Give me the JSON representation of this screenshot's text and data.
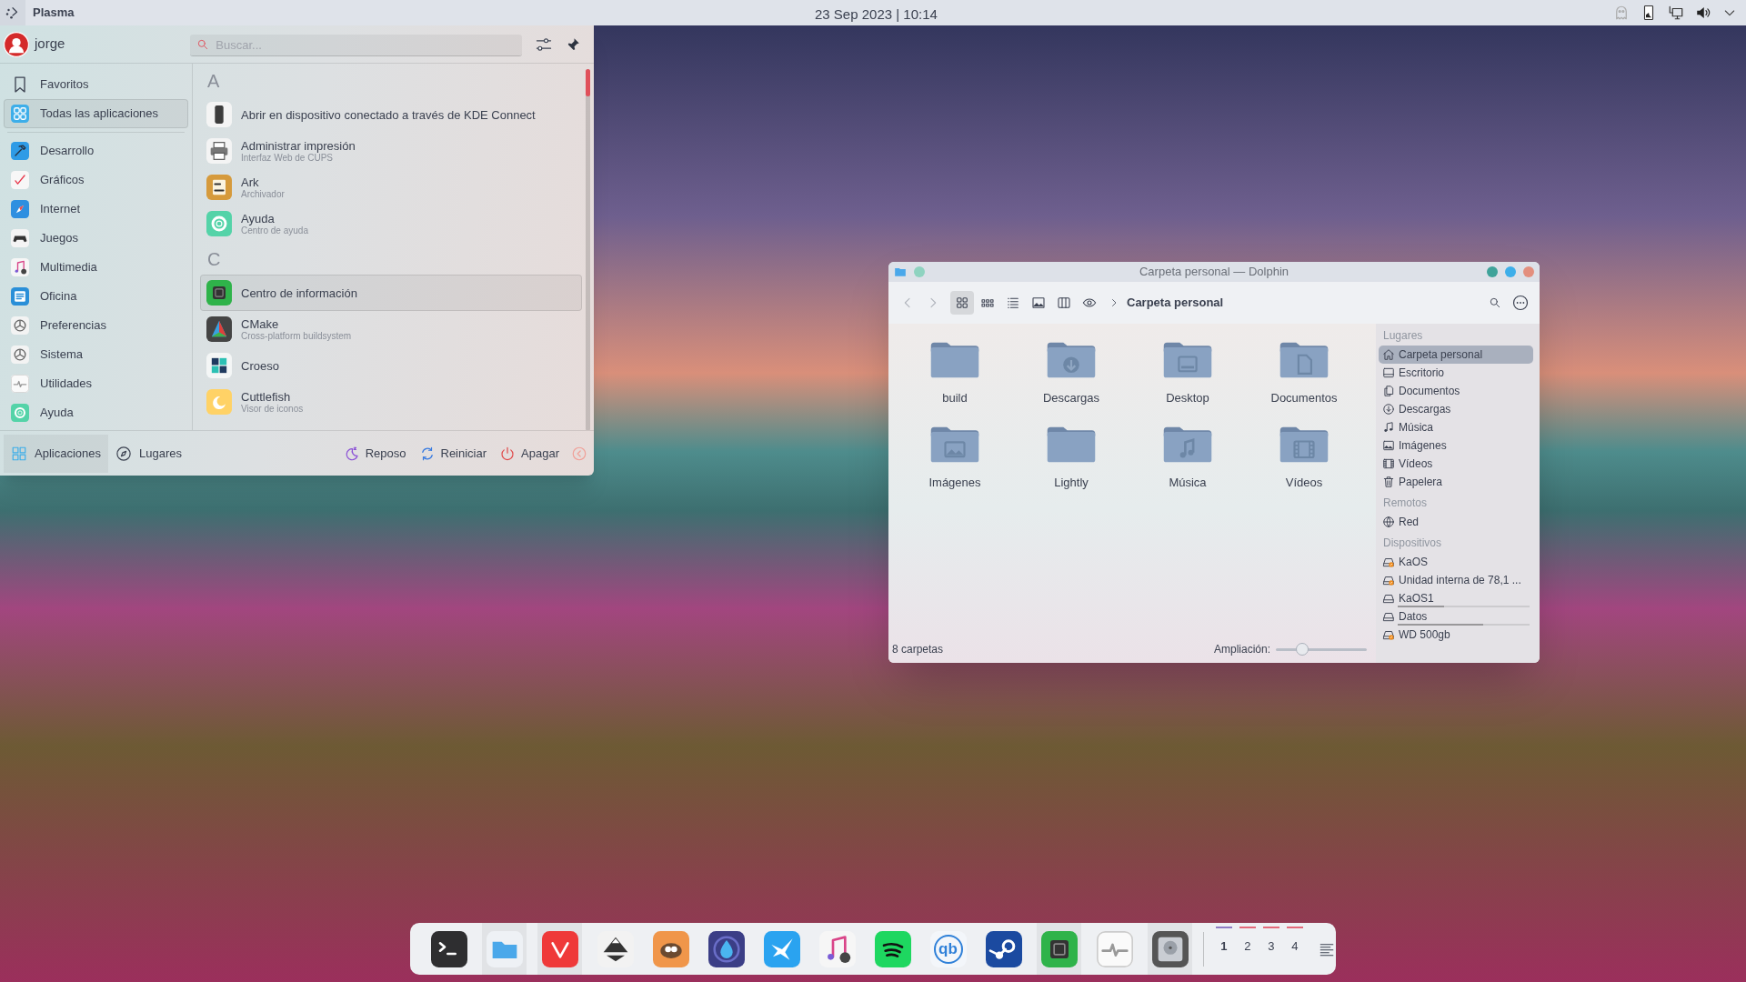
{
  "top_panel": {
    "app_title": "Plasma",
    "clock": "23 Sep 2023 | 10:14"
  },
  "launcher": {
    "user": "jorge",
    "search": {
      "placeholder": "Buscar..."
    },
    "pinned": [
      {
        "label": "Favoritos",
        "kind": "bookmark",
        "selected": false
      },
      {
        "label": "Todas las aplicaciones",
        "kind": "grid",
        "selected": true
      }
    ],
    "categories": [
      {
        "label": "Desarrollo",
        "kind": "hammer",
        "selected": false
      },
      {
        "label": "Gráficos",
        "kind": "brush",
        "selected": false
      },
      {
        "label": "Internet",
        "kind": "compass",
        "selected": false
      },
      {
        "label": "Juegos",
        "kind": "gamepad",
        "selected": false
      },
      {
        "label": "Multimedia",
        "kind": "note",
        "selected": false
      },
      {
        "label": "Oficina",
        "kind": "document",
        "selected": false
      },
      {
        "label": "Preferencias",
        "kind": "gear",
        "selected": false
      },
      {
        "label": "Sistema",
        "kind": "gear",
        "selected": false
      },
      {
        "label": "Utilidades",
        "kind": "pulse",
        "selected": false
      },
      {
        "label": "Ayuda",
        "kind": "lifebuoy",
        "selected": false
      }
    ],
    "sections": [
      {
        "letter": "A",
        "apps": [
          {
            "name": "Abrir en dispositivo conectado a través de KDE Connect",
            "kind": "phone",
            "selected": false
          },
          {
            "name": "Administrar impresión",
            "description": "Interfaz Web de CUPS",
            "kind": "printer",
            "selected": false
          },
          {
            "name": "Ark",
            "description": "Archivador",
            "kind": "package",
            "selected": false
          },
          {
            "name": "Ayuda",
            "description": "Centro de ayuda",
            "kind": "lifebuoy",
            "selected": false
          }
        ]
      },
      {
        "letter": "C",
        "apps": [
          {
            "name": "Centro de información",
            "kind": "chip",
            "selected": true
          },
          {
            "name": "CMake",
            "description": "Cross-platform buildsystem",
            "kind": "triangle",
            "selected": false
          },
          {
            "name": "Croeso",
            "kind": "squares",
            "selected": false
          },
          {
            "name": "Cuttlefish",
            "description": "Visor de iconos",
            "kind": "crescent",
            "selected": false
          }
        ]
      }
    ],
    "tabs": [
      {
        "label": "Aplicaciones",
        "kind": "grid-outline",
        "selected": true
      },
      {
        "label": "Lugares",
        "kind": "compass-outline",
        "selected": false
      }
    ],
    "power": [
      {
        "label": "Reposo",
        "kind": "moon"
      },
      {
        "label": "Reiniciar",
        "kind": "restart"
      },
      {
        "label": "Apagar",
        "kind": "power"
      }
    ]
  },
  "dolphin": {
    "title": "Carpeta personal — Dolphin",
    "breadcrumb": "Carpeta personal",
    "view_modes": [
      {
        "kind": "icons",
        "selected": true
      },
      {
        "kind": "compact",
        "selected": false
      },
      {
        "kind": "details",
        "selected": false
      },
      {
        "kind": "preview",
        "selected": false
      },
      {
        "kind": "split",
        "selected": false
      }
    ],
    "folders": [
      {
        "name": "build",
        "kind": "plain"
      },
      {
        "name": "Descargas",
        "kind": "download"
      },
      {
        "name": "Desktop",
        "kind": "desktop"
      },
      {
        "name": "Documentos",
        "kind": "document"
      },
      {
        "name": "Imágenes",
        "kind": "image"
      },
      {
        "name": "Lightly",
        "kind": "plain"
      },
      {
        "name": "Música",
        "kind": "music"
      },
      {
        "name": "Vídeos",
        "kind": "video"
      }
    ],
    "places": [
      {
        "heading": "Lugares",
        "items": [
          {
            "label": "Carpeta personal",
            "kind": "home",
            "selected": true
          },
          {
            "label": "Escritorio",
            "kind": "desktop",
            "selected": false
          },
          {
            "label": "Documentos",
            "kind": "documents",
            "selected": false
          },
          {
            "label": "Descargas",
            "kind": "download",
            "selected": false
          },
          {
            "label": "Música",
            "kind": "music",
            "selected": false
          },
          {
            "label": "Imágenes",
            "kind": "image",
            "selected": false
          },
          {
            "label": "Vídeos",
            "kind": "video",
            "selected": false
          },
          {
            "label": "Papelera",
            "kind": "trash",
            "selected": false
          }
        ]
      },
      {
        "heading": "Remotos",
        "items": [
          {
            "label": "Red",
            "kind": "network",
            "selected": false
          }
        ]
      },
      {
        "heading": "Dispositivos",
        "items": [
          {
            "label": "KaOS",
            "kind": "drive-warn",
            "selected": false
          },
          {
            "label": "Unidad interna de 78,1 ...",
            "kind": "drive-warn",
            "selected": false
          },
          {
            "label": "KaOS1",
            "kind": "drive",
            "selected": false,
            "level": 0.35
          },
          {
            "label": "Datos",
            "kind": "drive",
            "selected": false,
            "level": 0.65
          },
          {
            "label": "WD 500gb",
            "kind": "drive-warn",
            "selected": false
          }
        ]
      }
    ],
    "status": "8 carpetas",
    "zoom_label": "Ampliación:",
    "zoom": {
      "level": 0.29
    }
  },
  "dock": {
    "apps": [
      {
        "kind": "terminal",
        "running": false
      },
      {
        "kind": "folder",
        "running": true
      },
      {
        "kind": "vivaldi",
        "running": true
      },
      {
        "kind": "mountain",
        "running": false
      },
      {
        "kind": "fox",
        "running": false
      },
      {
        "kind": "drop",
        "running": false
      },
      {
        "kind": "bird",
        "running": false
      },
      {
        "kind": "note",
        "running": false
      },
      {
        "kind": "waves",
        "running": false
      },
      {
        "kind": "qb",
        "text": "qb",
        "running": false
      },
      {
        "kind": "steam",
        "running": false
      },
      {
        "kind": "chip",
        "running": true
      },
      {
        "kind": "pulse",
        "running": false
      },
      {
        "kind": "disk",
        "running": true
      }
    ],
    "desktops": [
      {
        "label": "1",
        "selected": true
      },
      {
        "label": "2",
        "selected": false
      },
      {
        "label": "3",
        "selected": false
      },
      {
        "label": "4",
        "selected": false
      }
    ]
  }
}
